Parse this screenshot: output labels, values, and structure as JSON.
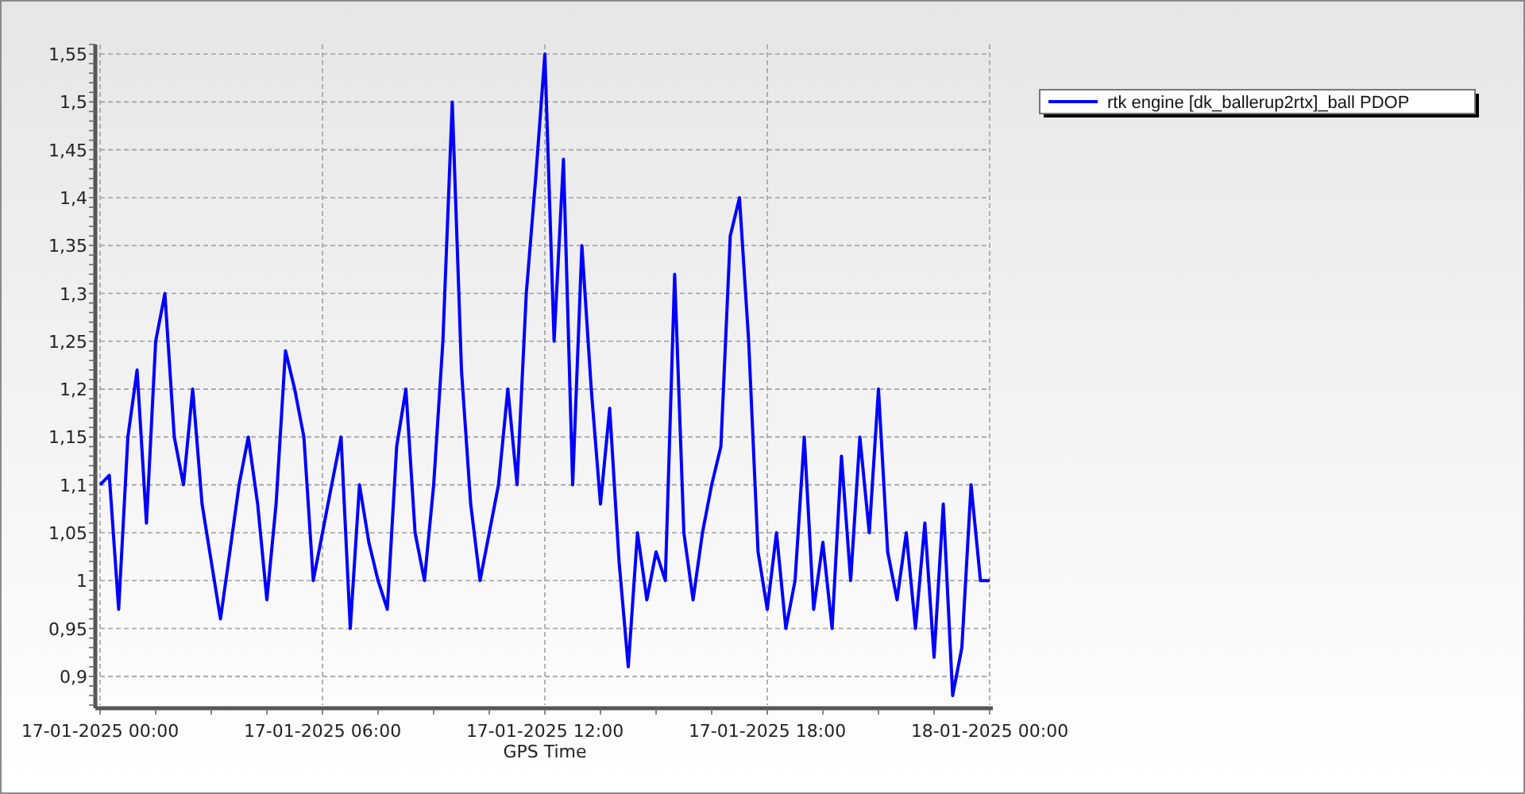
{
  "chart": {
    "chart_data": {
      "type": "line",
      "grid": true,
      "xlabel": "GPS Time",
      "categories": [
        "17-01-2025 00:00",
        null,
        null,
        null,
        null,
        null,
        null,
        null,
        null,
        null,
        null,
        null,
        null,
        null,
        null,
        null,
        null,
        null,
        null,
        null,
        null,
        null,
        null,
        null,
        "17-01-2025 06:00",
        null,
        null,
        null,
        null,
        null,
        null,
        null,
        null,
        null,
        null,
        null,
        null,
        null,
        null,
        null,
        null,
        null,
        null,
        null,
        null,
        null,
        null,
        null,
        "17-01-2025 12:00",
        null,
        null,
        null,
        null,
        null,
        null,
        null,
        null,
        null,
        null,
        null,
        null,
        null,
        null,
        null,
        null,
        null,
        null,
        null,
        null,
        null,
        null,
        null,
        "17-01-2025 18:00",
        null,
        null,
        null,
        null,
        null,
        null,
        null,
        null,
        null,
        null,
        null,
        null,
        null,
        null,
        null,
        null,
        null,
        null,
        null,
        null,
        null,
        null,
        null,
        "18-01-2025 00:00"
      ],
      "series": [
        {
          "name": "rtk engine [dk_ballerup2rtx]_ball PDOP",
          "color": "#0000ff",
          "values": [
            1.1,
            1.11,
            0.97,
            1.15,
            1.22,
            1.06,
            1.25,
            1.3,
            1.15,
            1.1,
            1.2,
            1.08,
            1.02,
            0.96,
            1.03,
            1.1,
            1.15,
            1.08,
            0.98,
            1.08,
            1.24,
            1.2,
            1.15,
            1.0,
            1.05,
            1.1,
            1.15,
            0.95,
            1.1,
            1.04,
            1.0,
            0.97,
            1.14,
            1.2,
            1.05,
            1.0,
            1.1,
            1.25,
            1.5,
            1.22,
            1.08,
            1.0,
            1.05,
            1.1,
            1.2,
            1.1,
            1.3,
            1.42,
            1.55,
            1.25,
            1.44,
            1.1,
            1.35,
            1.2,
            1.08,
            1.18,
            1.02,
            0.91,
            1.05,
            0.98,
            1.03,
            1.0,
            1.32,
            1.05,
            0.98,
            1.05,
            1.1,
            1.14,
            1.36,
            1.4,
            1.25,
            1.03,
            0.97,
            1.05,
            0.95,
            1.0,
            1.15,
            0.97,
            1.04,
            0.95,
            1.13,
            1.0,
            1.15,
            1.05,
            1.2,
            1.03,
            0.98,
            1.05,
            0.95,
            1.06,
            0.92,
            1.08,
            0.88,
            0.93,
            1.1,
            1.0,
            1.0
          ]
        }
      ],
      "ylim": [
        0.87,
        1.56
      ],
      "yticks": [
        {
          "value": 0.9,
          "label": "0,9"
        },
        {
          "value": 0.95,
          "label": "0,95"
        },
        {
          "value": 1,
          "label": "1"
        },
        {
          "value": 1.05,
          "label": "1,05"
        },
        {
          "value": 1.1,
          "label": "1,1"
        },
        {
          "value": 1.15,
          "label": "1,15"
        },
        {
          "value": 1.2,
          "label": "1,2"
        },
        {
          "value": 1.25,
          "label": "1,25"
        },
        {
          "value": 1.3,
          "label": "1,3"
        },
        {
          "value": 1.35,
          "label": "1,35"
        },
        {
          "value": 1.4,
          "label": "1,4"
        },
        {
          "value": 1.45,
          "label": "1,45"
        },
        {
          "value": 1.5,
          "label": "1,5"
        },
        {
          "value": 1.55,
          "label": "1,55"
        }
      ]
    }
  }
}
